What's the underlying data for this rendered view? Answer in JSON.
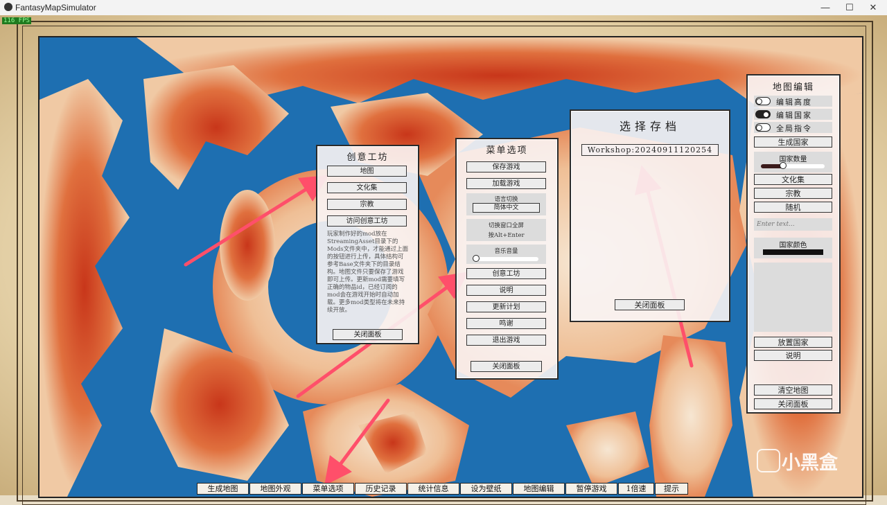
{
  "window": {
    "title": "FantasyMapSimulator",
    "minimize": "—",
    "maximize": "☐",
    "close": "✕"
  },
  "fps": "116 FPS",
  "workshop": {
    "title": "创意工坊",
    "buttons": [
      "地图",
      "文化集",
      "宗教",
      "访问创意工坊"
    ],
    "desc": "玩家制作好的mod放在StreamingAsset目录下的Mods文件夹中，才能通过上面的按钮进行上传，具体结构可参考Base文件夹下的目录结构。地图文件只要保存了游戏即可上传。更新mod需要填写正确的物品id，已经订阅的mod会在游戏开始时自动加载。更多mod类型将在未来持续开放。",
    "close": "关闭面板"
  },
  "menu": {
    "title": "菜单选项",
    "save": "保存游戏",
    "load": "加载游戏",
    "lang_label": "语言切换",
    "lang_value": "简体中文",
    "fullscreen_label": "切换窗口全屏",
    "fullscreen_hint": "按Alt+Enter",
    "music_label": "音乐音量",
    "music_volume": 0.0,
    "workshop": "创意工坊",
    "help": "说明",
    "update": "更新计划",
    "thanks": "鸣谢",
    "quit": "退出游戏",
    "close": "关闭面板"
  },
  "saves": {
    "title": "选择存档",
    "items": [
      "Workshop:20240911120254"
    ],
    "close": "关闭面板"
  },
  "editor": {
    "title": "地图编辑",
    "toggles": [
      {
        "label": "编辑高度",
        "on": false
      },
      {
        "label": "编辑国家",
        "on": true
      },
      {
        "label": "全局指令",
        "on": false
      }
    ],
    "generate_country": "生成国家",
    "country_count_label": "国家数量",
    "country_count": 0.35,
    "culture": "文化集",
    "religion": "宗教",
    "random": "随机",
    "input_placeholder": "Enter text...",
    "color_label": "国家颜色",
    "color_value": "#111111",
    "place_country": "放置国家",
    "help": "说明",
    "clear_map": "清空地图",
    "close": "关闭面板"
  },
  "bottombar": [
    "生成地图",
    "地图外观",
    "菜单选项",
    "历史记录",
    "统计信息",
    "设为壁纸",
    "地图编辑",
    "暂停游戏",
    "1倍速",
    "提示"
  ],
  "watermark": "小黑盒",
  "colors": {
    "sea": "#1e6fb1",
    "land_hot": "#d8401c",
    "land_warm": "#eb9466",
    "land_light": "#f4dcc0",
    "arrow": "#ff4f6a"
  }
}
